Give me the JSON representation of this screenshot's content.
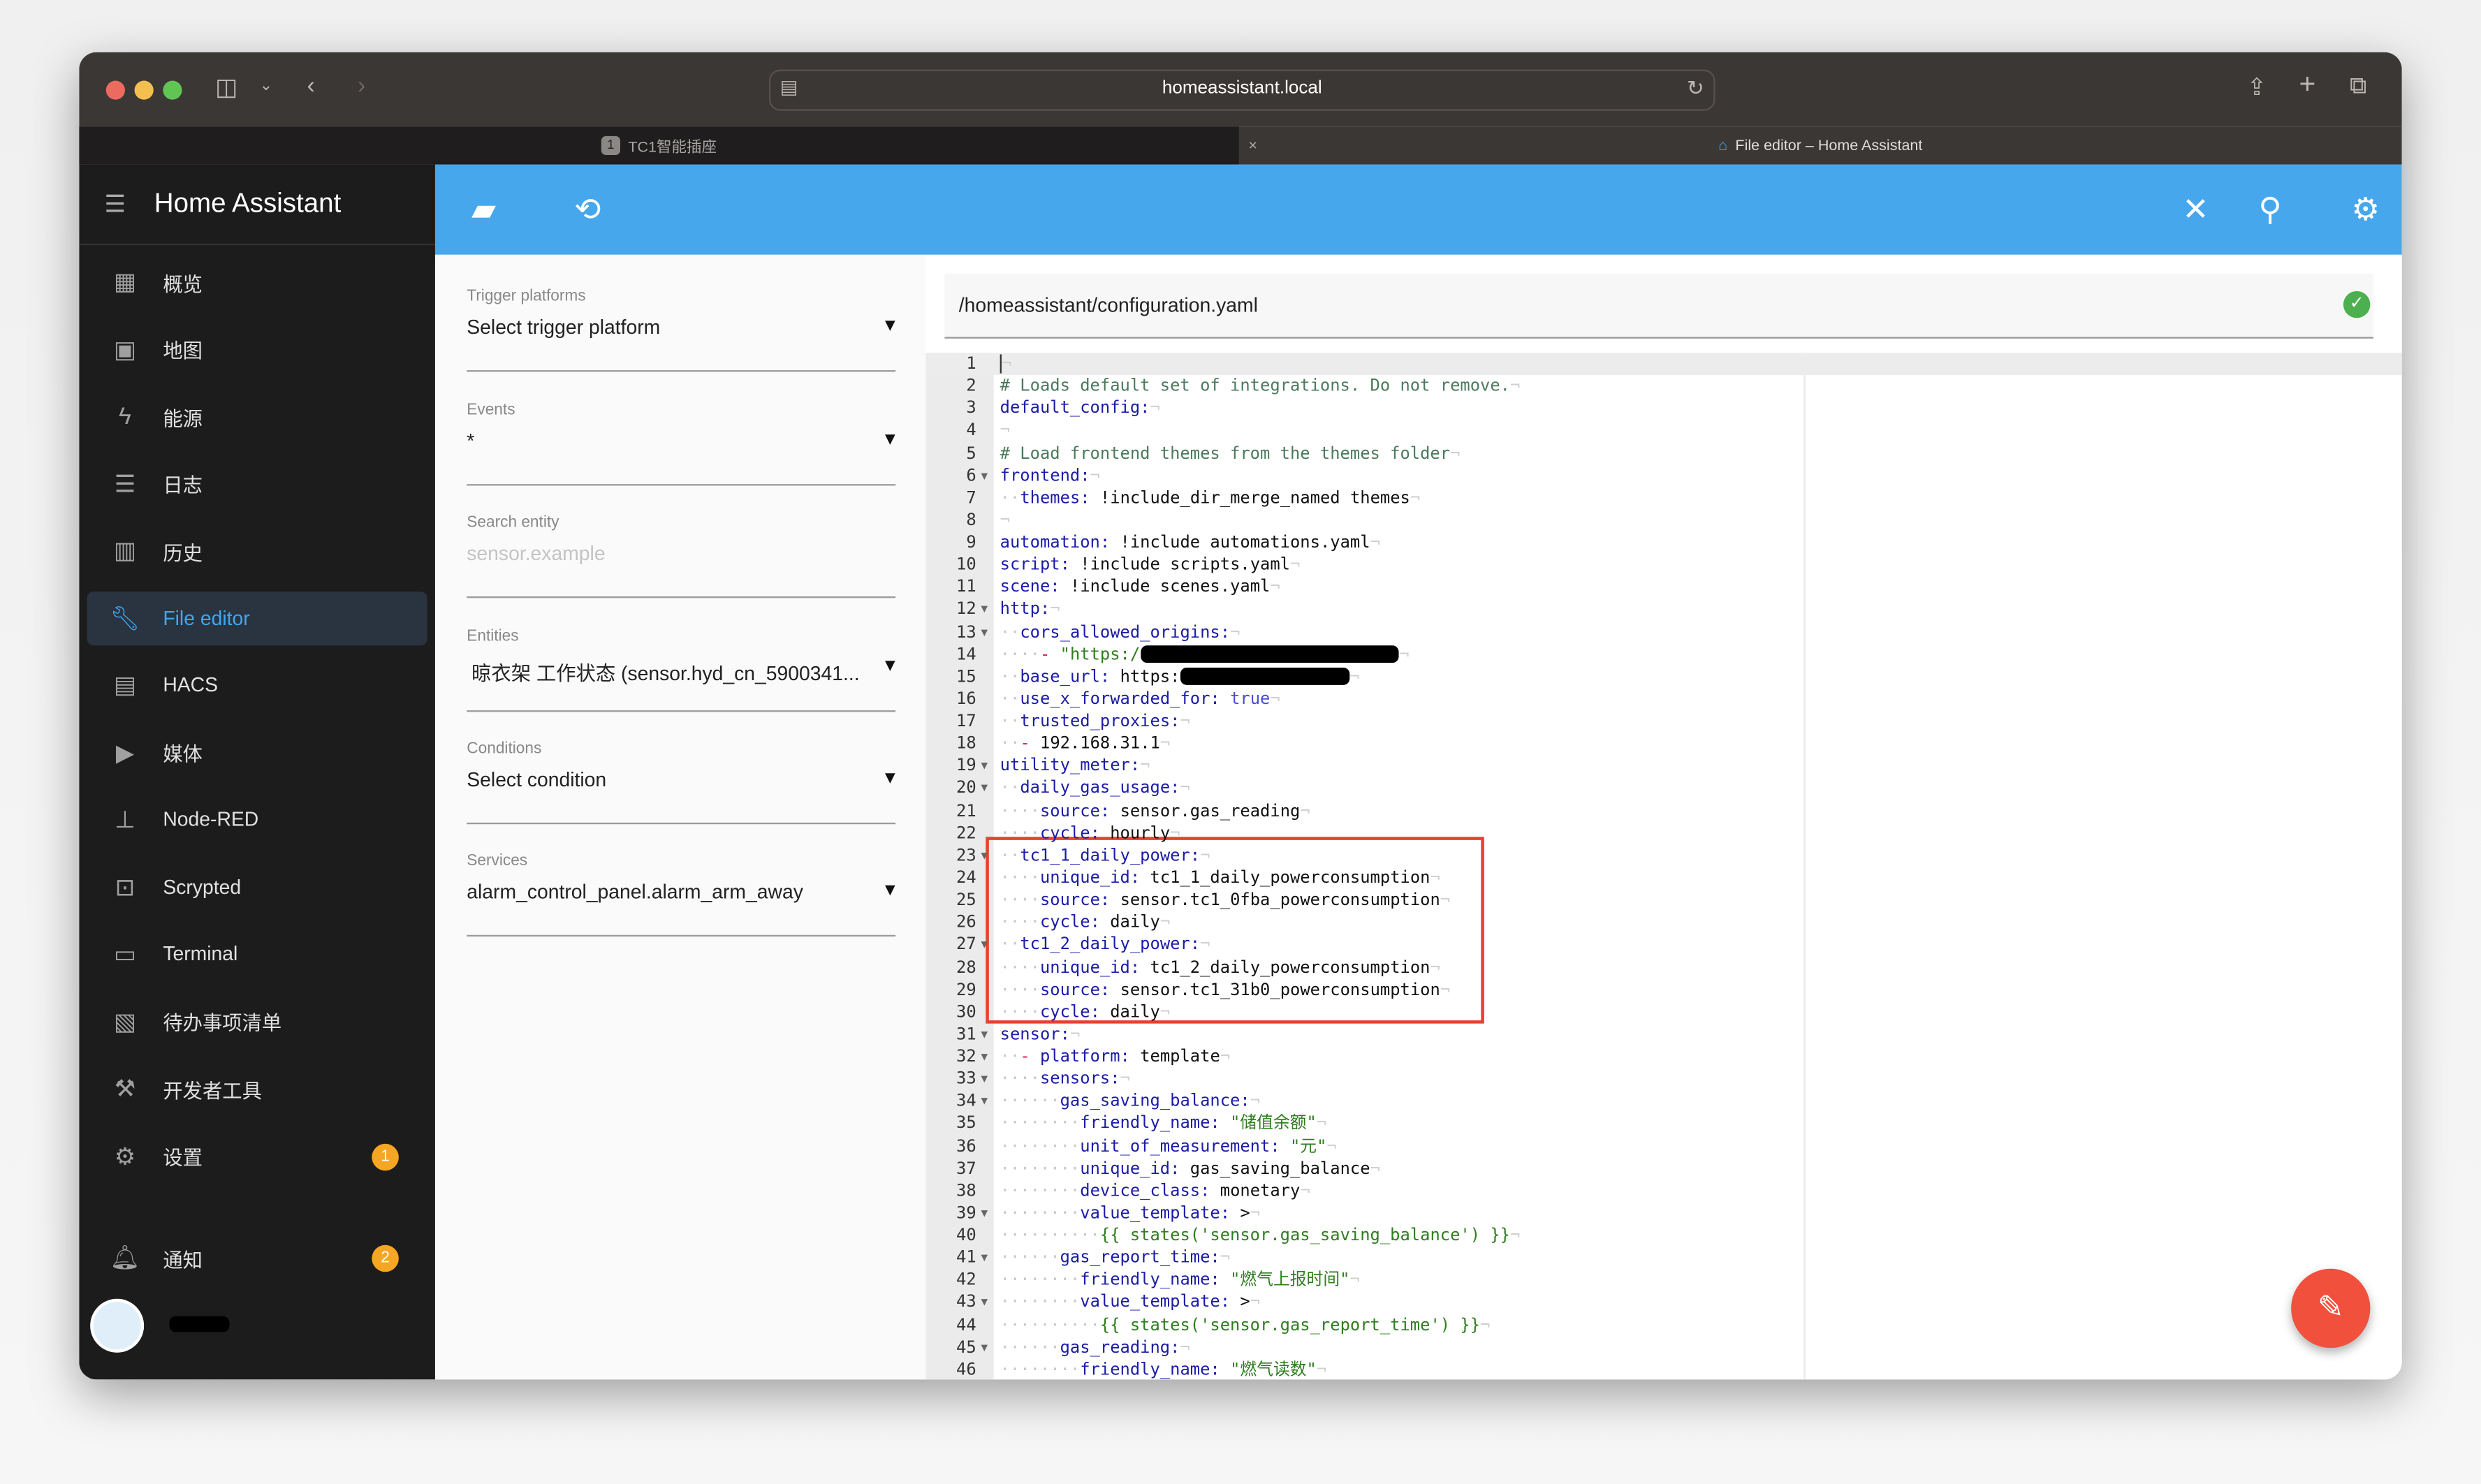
{
  "browser": {
    "url": "homeassistant.local",
    "tabs": [
      {
        "label": "TC1智能插座",
        "badge": "1"
      },
      {
        "label": "File editor – Home Assistant"
      }
    ]
  },
  "sidebar": {
    "title": "Home Assistant",
    "items": [
      {
        "label": "概览",
        "icon": "dashboard-icon"
      },
      {
        "label": "地图",
        "icon": "map-icon"
      },
      {
        "label": "能源",
        "icon": "lightning-icon"
      },
      {
        "label": "日志",
        "icon": "list-icon"
      },
      {
        "label": "历史",
        "icon": "chart-icon"
      },
      {
        "label": "File editor",
        "icon": "wrench-icon",
        "active": true
      },
      {
        "label": "HACS",
        "icon": "hacs-icon"
      },
      {
        "label": "媒体",
        "icon": "media-icon"
      },
      {
        "label": "Node-RED",
        "icon": "sitemap-icon"
      },
      {
        "label": "Scrypted",
        "icon": "chip-icon"
      },
      {
        "label": "Terminal",
        "icon": "terminal-icon"
      },
      {
        "label": "待办事项清单",
        "icon": "clipboard-icon"
      },
      {
        "label": "开发者工具",
        "icon": "hammer-icon"
      },
      {
        "label": "设置",
        "icon": "gear-icon",
        "badge": "1"
      }
    ],
    "notifications": {
      "label": "通知",
      "badge": "2"
    }
  },
  "form": {
    "trigger": {
      "label": "Trigger platforms",
      "value": "Select trigger platform"
    },
    "events": {
      "label": "Events",
      "value": "*"
    },
    "search": {
      "label": "Search entity",
      "placeholder": "sensor.example"
    },
    "entities": {
      "label": "Entities",
      "value": "晾衣架 工作状态 (sensor.hyd_cn_5900341..."
    },
    "conditions": {
      "label": "Conditions",
      "value": "Select condition"
    },
    "services": {
      "label": "Services",
      "value": "alarm_control_panel.alarm_arm_away"
    }
  },
  "editor": {
    "path": "/homeassistant/configuration.yaml",
    "lines": [
      {
        "n": "1",
        "i": 0,
        "t": []
      },
      {
        "n": "2",
        "i": 0,
        "t": [
          [
            "c",
            "# Loads default set of integrations. Do not remove."
          ]
        ]
      },
      {
        "n": "3",
        "i": 0,
        "t": [
          [
            "k",
            "default_config:"
          ]
        ]
      },
      {
        "n": "4",
        "i": 0,
        "t": []
      },
      {
        "n": "5",
        "i": 0,
        "t": [
          [
            "c",
            "# Load frontend themes from the themes folder"
          ]
        ]
      },
      {
        "n": "6",
        "i": 0,
        "f": true,
        "t": [
          [
            "k",
            "frontend:"
          ]
        ]
      },
      {
        "n": "7",
        "i": 2,
        "t": [
          [
            "k",
            "themes:"
          ],
          [
            "v",
            " !include_dir_merge_named themes"
          ]
        ]
      },
      {
        "n": "8",
        "i": 0,
        "t": []
      },
      {
        "n": "9",
        "i": 0,
        "t": [
          [
            "k",
            "automation:"
          ],
          [
            "v",
            " !include automations.yaml"
          ]
        ]
      },
      {
        "n": "10",
        "i": 0,
        "t": [
          [
            "k",
            "script:"
          ],
          [
            "v",
            " !include scripts.yaml"
          ]
        ]
      },
      {
        "n": "11",
        "i": 0,
        "t": [
          [
            "k",
            "scene:"
          ],
          [
            "v",
            " !include scenes.yaml"
          ]
        ]
      },
      {
        "n": "12",
        "i": 0,
        "f": true,
        "t": [
          [
            "k",
            "http:"
          ]
        ]
      },
      {
        "n": "13",
        "i": 2,
        "f": true,
        "t": [
          [
            "k",
            "cors_allowed_origins:"
          ]
        ]
      },
      {
        "n": "14",
        "i": 4,
        "t": [
          [
            "d",
            "-"
          ],
          [
            "s",
            " \"https:/"
          ],
          [
            "r",
            "26"
          ]
        ]
      },
      {
        "n": "15",
        "i": 2,
        "t": [
          [
            "k",
            "base_url:"
          ],
          [
            "v",
            " https:"
          ],
          [
            "r",
            "17"
          ]
        ]
      },
      {
        "n": "16",
        "i": 2,
        "t": [
          [
            "k",
            "use_x_forwarded_for:"
          ],
          [
            "b",
            " true"
          ]
        ]
      },
      {
        "n": "17",
        "i": 2,
        "t": [
          [
            "k",
            "trusted_proxies:"
          ]
        ]
      },
      {
        "n": "18",
        "i": 2,
        "t": [
          [
            "d",
            "-"
          ],
          [
            "v",
            " 192.168.31.1"
          ]
        ]
      },
      {
        "n": "19",
        "i": 0,
        "f": true,
        "t": [
          [
            "k",
            "utility_meter:"
          ]
        ]
      },
      {
        "n": "20",
        "i": 2,
        "f": true,
        "t": [
          [
            "k",
            "daily_gas_usage:"
          ]
        ]
      },
      {
        "n": "21",
        "i": 4,
        "t": [
          [
            "k",
            "source:"
          ],
          [
            "v",
            " sensor.gas_reading"
          ]
        ]
      },
      {
        "n": "22",
        "i": 4,
        "t": [
          [
            "k",
            "cycle:"
          ],
          [
            "v",
            " hourly"
          ]
        ]
      },
      {
        "n": "23",
        "i": 2,
        "f": true,
        "t": [
          [
            "k",
            "tc1_1_daily_power:"
          ]
        ]
      },
      {
        "n": "24",
        "i": 4,
        "t": [
          [
            "k",
            "unique_id:"
          ],
          [
            "v",
            " tc1_1_daily_powerconsumption"
          ]
        ]
      },
      {
        "n": "25",
        "i": 4,
        "t": [
          [
            "k",
            "source:"
          ],
          [
            "v",
            " sensor.tc1_0fba_powerconsumption"
          ]
        ]
      },
      {
        "n": "26",
        "i": 4,
        "t": [
          [
            "k",
            "cycle:"
          ],
          [
            "v",
            " daily"
          ]
        ]
      },
      {
        "n": "27",
        "i": 2,
        "f": true,
        "t": [
          [
            "k",
            "tc1_2_daily_power:"
          ]
        ]
      },
      {
        "n": "28",
        "i": 4,
        "t": [
          [
            "k",
            "unique_id:"
          ],
          [
            "v",
            " tc1_2_daily_powerconsumption"
          ]
        ]
      },
      {
        "n": "29",
        "i": 4,
        "t": [
          [
            "k",
            "source:"
          ],
          [
            "v",
            " sensor.tc1_31b0_powerconsumption"
          ]
        ]
      },
      {
        "n": "30",
        "i": 4,
        "t": [
          [
            "k",
            "cycle:"
          ],
          [
            "v",
            " daily"
          ]
        ]
      },
      {
        "n": "31",
        "i": 0,
        "f": true,
        "t": [
          [
            "k",
            "sensor:"
          ]
        ]
      },
      {
        "n": "32",
        "i": 2,
        "f": true,
        "t": [
          [
            "d",
            "-"
          ],
          [
            "k",
            " platform:"
          ],
          [
            "v",
            " template"
          ]
        ]
      },
      {
        "n": "33",
        "i": 4,
        "f": true,
        "t": [
          [
            "k",
            "sensors:"
          ]
        ]
      },
      {
        "n": "34",
        "i": 6,
        "f": true,
        "t": [
          [
            "k",
            "gas_saving_balance:"
          ]
        ]
      },
      {
        "n": "35",
        "i": 8,
        "t": [
          [
            "k",
            "friendly_name:"
          ],
          [
            "s",
            " \"储值余额\""
          ]
        ]
      },
      {
        "n": "36",
        "i": 8,
        "t": [
          [
            "k",
            "unit_of_measurement:"
          ],
          [
            "s",
            " \"元\""
          ]
        ]
      },
      {
        "n": "37",
        "i": 8,
        "t": [
          [
            "k",
            "unique_id:"
          ],
          [
            "v",
            " gas_saving_balance"
          ]
        ]
      },
      {
        "n": "38",
        "i": 8,
        "t": [
          [
            "k",
            "device_class:"
          ],
          [
            "v",
            " monetary"
          ]
        ]
      },
      {
        "n": "39",
        "i": 8,
        "f": true,
        "t": [
          [
            "k",
            "value_template:"
          ],
          [
            "v",
            " >"
          ]
        ]
      },
      {
        "n": "40",
        "i": 10,
        "t": [
          [
            "s",
            "{{ states('sensor.gas_saving_balance') }}"
          ]
        ]
      },
      {
        "n": "41",
        "i": 6,
        "f": true,
        "t": [
          [
            "k",
            "gas_report_time:"
          ]
        ]
      },
      {
        "n": "42",
        "i": 8,
        "t": [
          [
            "k",
            "friendly_name:"
          ],
          [
            "s",
            " \"燃气上报时间\""
          ]
        ]
      },
      {
        "n": "43",
        "i": 8,
        "f": true,
        "t": [
          [
            "k",
            "value_template:"
          ],
          [
            "v",
            " >"
          ]
        ]
      },
      {
        "n": "44",
        "i": 10,
        "t": [
          [
            "s",
            "{{ states('sensor.gas_report_time') }}"
          ]
        ]
      },
      {
        "n": "45",
        "i": 6,
        "f": true,
        "t": [
          [
            "k",
            "gas_reading:"
          ]
        ]
      },
      {
        "n": "46",
        "i": 8,
        "t": [
          [
            "k",
            "friendly_name:"
          ],
          [
            "s",
            " \"燃气读数\""
          ]
        ]
      }
    ]
  },
  "colors": {
    "header": "#46a7ec",
    "fab": "#f0503c",
    "highlight_box": "#e8412e",
    "active_item": "#3fa7f0",
    "badge": "#f5a623"
  }
}
